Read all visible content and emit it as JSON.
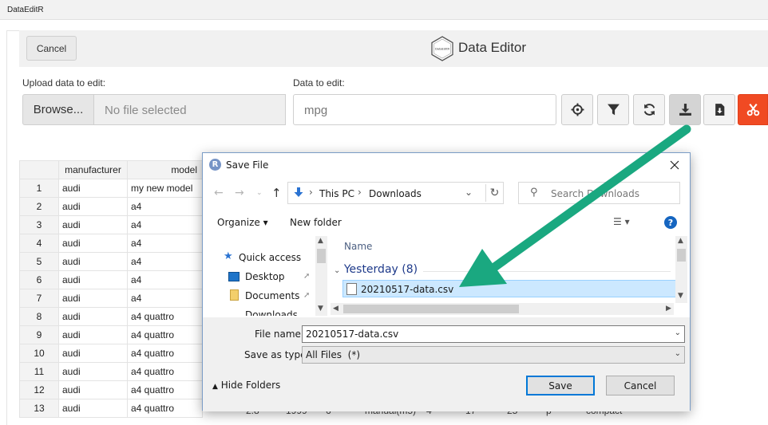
{
  "app": {
    "window_title": "DataEditR"
  },
  "header": {
    "cancel_label": "Cancel",
    "title": "Data Editor",
    "logo_text": "DataEditR"
  },
  "upload": {
    "label": "Upload data to edit:",
    "browse_label": "Browse...",
    "file_placeholder": "No file selected"
  },
  "data_select": {
    "label": "Data to edit:",
    "value": "mpg"
  },
  "toolbar": {
    "icons": [
      "crosshair-icon",
      "filter-icon",
      "sync-icon",
      "download-icon",
      "file-download-icon",
      "cut-icon"
    ]
  },
  "grid": {
    "columns": [
      "",
      "manufacturer",
      "model"
    ],
    "rows": [
      [
        "1",
        "audi",
        "my new model"
      ],
      [
        "2",
        "audi",
        "a4"
      ],
      [
        "3",
        "audi",
        "a4"
      ],
      [
        "4",
        "audi",
        "a4"
      ],
      [
        "5",
        "audi",
        "a4"
      ],
      [
        "6",
        "audi",
        "a4"
      ],
      [
        "7",
        "audi",
        "a4"
      ],
      [
        "8",
        "audi",
        "a4 quattro"
      ],
      [
        "9",
        "audi",
        "a4 quattro"
      ],
      [
        "10",
        "audi",
        "a4 quattro"
      ],
      [
        "11",
        "audi",
        "a4 quattro"
      ],
      [
        "12",
        "audi",
        "a4 quattro"
      ],
      [
        "13",
        "audi",
        "a4 quattro"
      ]
    ],
    "row13_extra": [
      "2.8",
      "1999",
      "6",
      "manual(m5)",
      "4",
      "17",
      "25",
      "p",
      "compact"
    ]
  },
  "dialog": {
    "title": "Save File",
    "address": {
      "crumbs": [
        "This PC",
        "Downloads"
      ]
    },
    "search_placeholder": "Search Downloads",
    "organize_label": "Organize",
    "new_folder_label": "New folder",
    "nav_items": [
      "Quick access",
      "Desktop",
      "Documents",
      "Downloads"
    ],
    "column_name": "Name",
    "group_header": "Yesterday (8)",
    "selected_file": "20210517-data.csv",
    "file_name_label": "File name:",
    "file_name_value": "20210517-data.csv",
    "save_as_type_label": "Save as type:",
    "save_as_type_value": "All Files  (*)",
    "hide_folders_label": "Hide Folders",
    "save_label": "Save",
    "cancel_label": "Cancel"
  },
  "colors": {
    "danger": "#f04a23",
    "arrow": "#1aa880",
    "selection": "#cce8ff",
    "primary_border": "#0078d7"
  }
}
